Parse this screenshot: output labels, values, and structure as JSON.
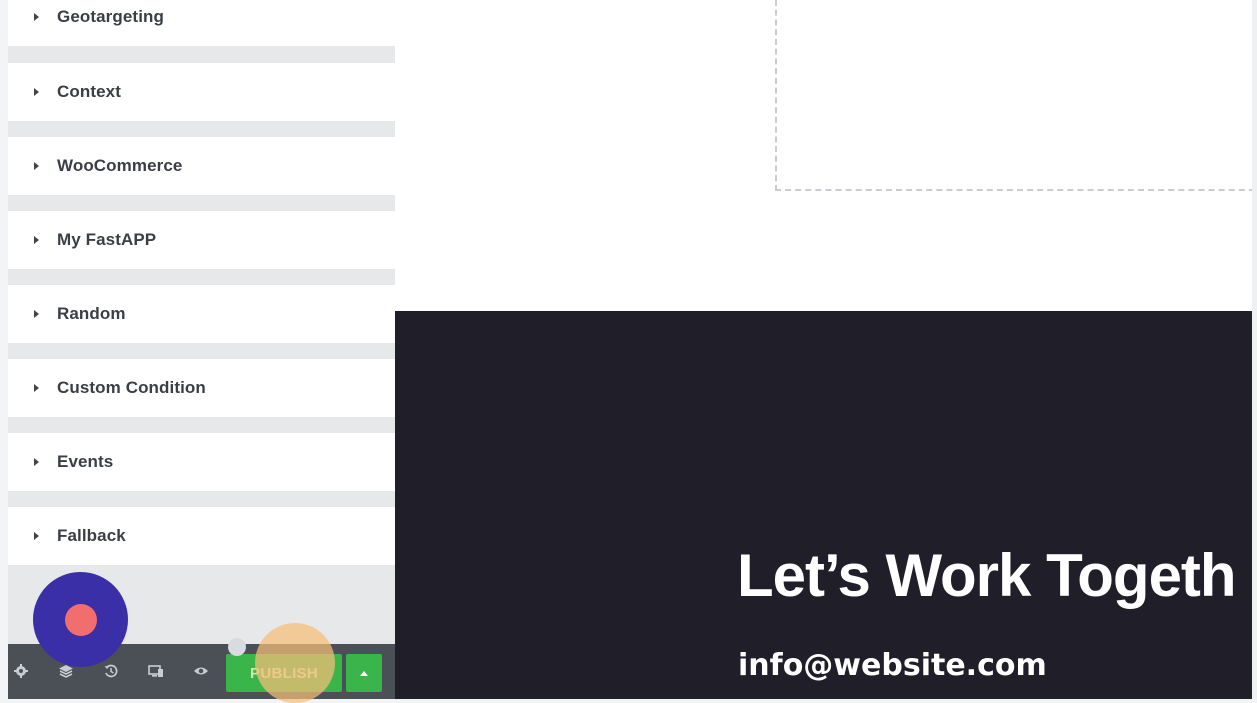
{
  "panel": {
    "sections": [
      {
        "label": "Geotargeting"
      },
      {
        "label": "Context"
      },
      {
        "label": "WooCommerce"
      },
      {
        "label": "My FastAPP"
      },
      {
        "label": "Random"
      },
      {
        "label": "Custom Condition"
      },
      {
        "label": "Events"
      },
      {
        "label": "Fallback"
      }
    ],
    "collapse_icon": "chevron-left-icon"
  },
  "toolbar": {
    "icons": [
      "gear-icon",
      "layers-icon",
      "history-icon",
      "responsive-icon",
      "eye-icon"
    ],
    "publish_label": "PUBLISH",
    "publish_options_icon": "caret-up-icon"
  },
  "canvas": {
    "headline": "Let’s Work Togeth",
    "email": "info@website.com"
  },
  "overlay": {
    "record_button": "record-icon"
  },
  "colors": {
    "publish_green": "#39b54a",
    "toolbar_bg": "#4a5056",
    "dark_section": "#1f1e29",
    "record_purple": "#3a2fa7",
    "record_dot": "#f26d6d"
  }
}
